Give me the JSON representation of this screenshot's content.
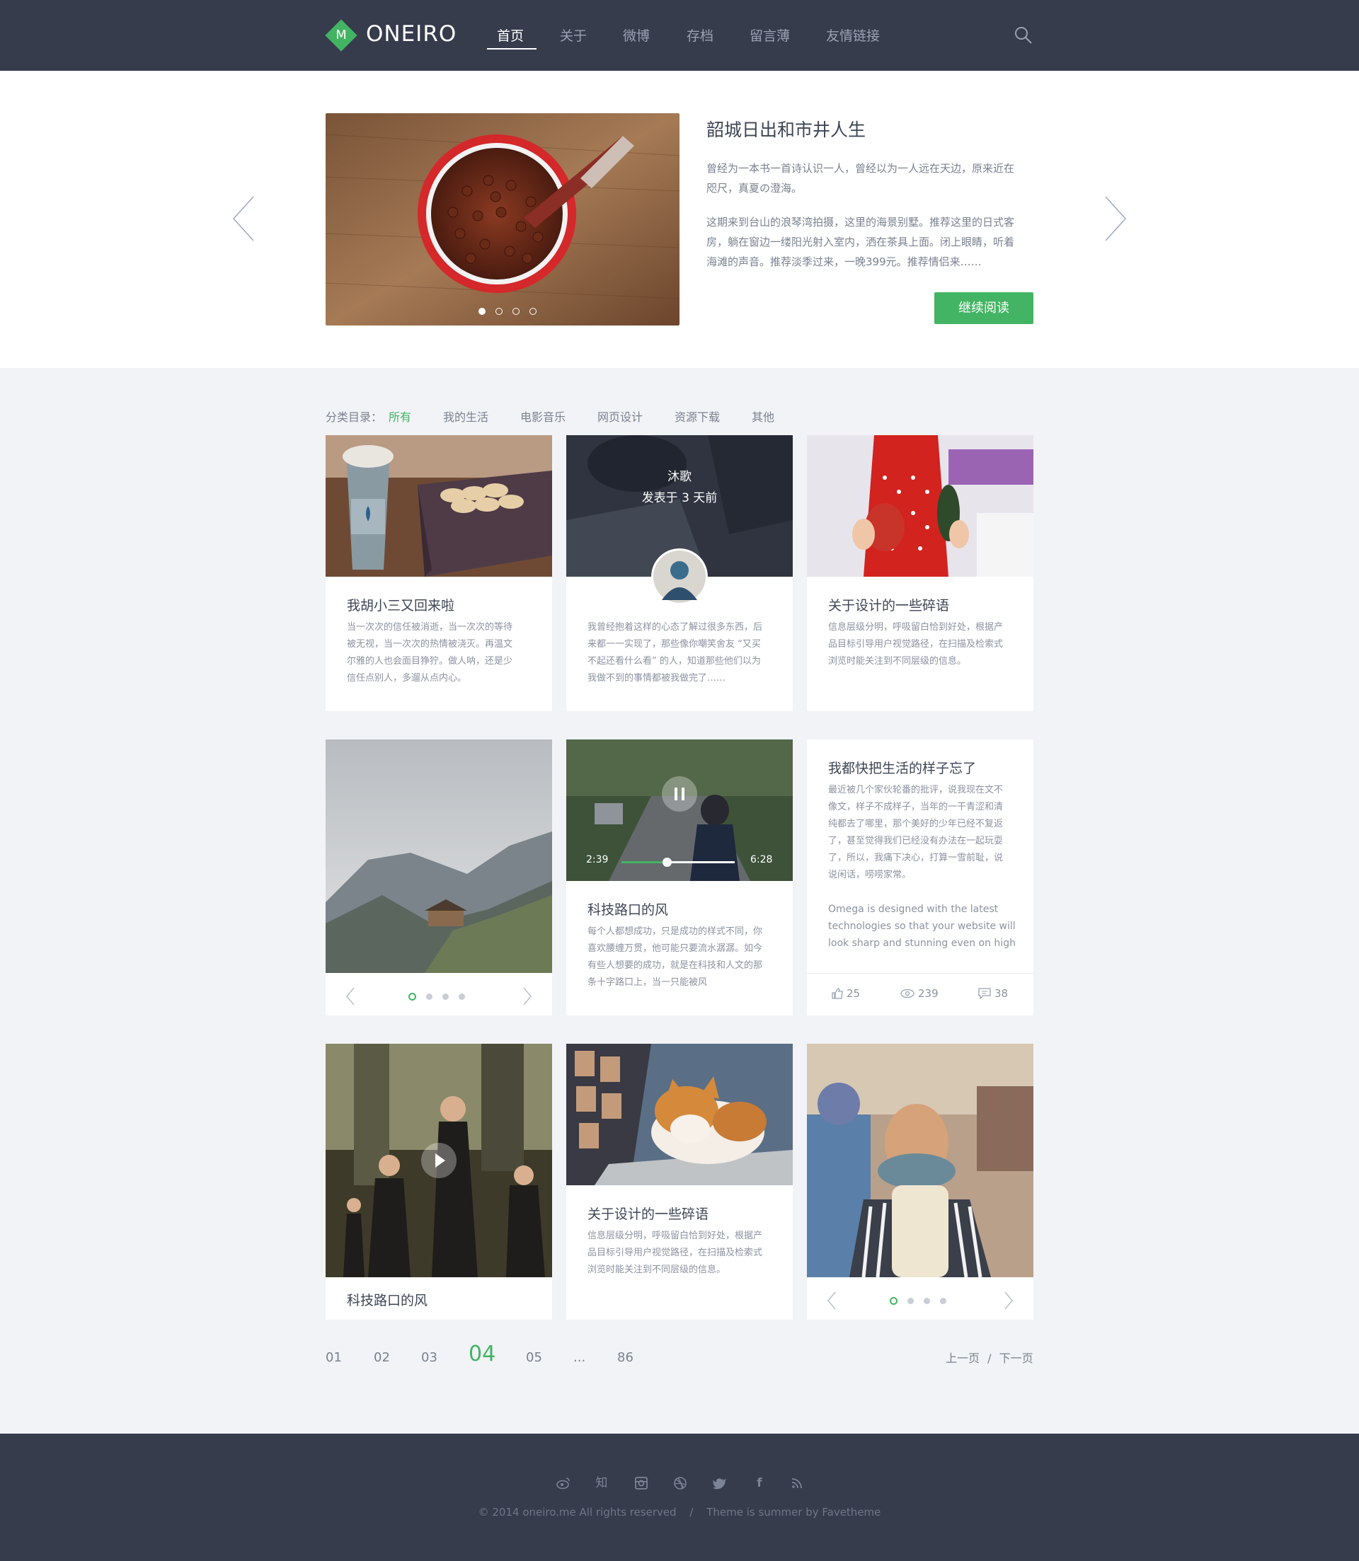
{
  "brand": {
    "logo_letter": "M",
    "name": "ONEIRO"
  },
  "nav": {
    "items": [
      "首页",
      "关于",
      "微博",
      "存档",
      "留言薄",
      "友情链接"
    ],
    "active": "首页"
  },
  "hero": {
    "title": "韶城日出和市井人生",
    "p1_l1": "曾经为一本书一首诗认识一人，曾经以为一人远在天边，原来近在",
    "p1_l2": "咫尺，真夏の澄海。",
    "p2_l1": "这期来到台山的浪琴湾拍摄，这里的海景别墅。推荐这里的日式客",
    "p2_l2": "房，躺在窗边一缕阳光射入室内，洒在茶具上面。闭上眼睛，听着",
    "p2_l3": "海滩的声音。推荐淡季过来，一晚399元。推荐情侣来……",
    "button": "继续阅读",
    "slide_count": 4,
    "slide_active": 1
  },
  "categories": {
    "label": "分类目录：",
    "items": [
      "所有",
      "我的生活",
      "电影音乐",
      "网页设计",
      "资源下载",
      "其他"
    ],
    "active": "所有"
  },
  "cards": {
    "c1": {
      "title": "我胡小三又回来啦",
      "lines": [
        "当一次次的信任被消逝，当一次次的等待",
        "被无视，当一次次的热情被浇灭。再温文",
        "尔雅的人也会面目狰狞。做人呐，还是少",
        "信任点别人，多遛从点内心。"
      ]
    },
    "c2": {
      "author": "沐歌",
      "posted": "发表于 3 天前",
      "lines": [
        "我曾经抱着这样的心态了解过很多东西，后",
        "来都一一实现了，那些像你嘲笑舍友 “又买",
        "不起还看什么看” 的人，知道那些他们以为",
        "我做不到的事情都被我做完了……"
      ]
    },
    "c3": {
      "title": "关于设计的一些碎语",
      "lines": [
        "信息层级分明，呼吸留白恰到好处，根据产",
        "品目标引导用户视觉路径，在扫描及检索式",
        "浏览时能关注到不同层级的信息。"
      ]
    },
    "c4": {
      "slide_count": 4,
      "slide_active": 1
    },
    "c5": {
      "title": "科技路口的风",
      "time_current": "2:39",
      "time_total": "6:28",
      "progress": 0.4,
      "lines": [
        "每个人都想成功，只是成功的样式不同，你",
        "喜欢腰缠万贯，他可能只要流水潺潺。如今",
        "有些人想要的成功，就是在科技和人文的那",
        "条十字路口上，当一只能被风"
      ]
    },
    "c6": {
      "title": "我都快把生活的样子忘了",
      "lines": [
        "最近被几个家伙轮番的批评，说我现在文不",
        "像文，样子不成样子，当年的一干青涩和清",
        "纯都去了哪里，那个美好的少年已经不复返",
        "了，甚至觉得我们已经没有办法在一起玩耍",
        "了，所以，我痛下决心，打算一雪前耻，说",
        "说闲话，唠唠家常。"
      ],
      "en_lines": [
        "Omega is designed with the latest",
        "technologies so that your website will",
        "look sharp and stunning even on high"
      ],
      "likes": "25",
      "views": "239",
      "comments": "38"
    },
    "c7": {
      "title": "科技路口的风"
    },
    "c8": {
      "title": "关于设计的一些碎语",
      "lines": [
        "信息层级分明，呼吸留白恰到好处，根据产",
        "品目标引导用户视觉路径，在扫描及检索式",
        "浏览时能关注到不同层级的信息。"
      ]
    },
    "c9": {
      "slide_count": 4,
      "slide_active": 1
    }
  },
  "pagination": {
    "pages": [
      "01",
      "02",
      "03",
      "04",
      "05",
      "...",
      "86"
    ],
    "current": "04",
    "prev": "上一页",
    "sep": "/",
    "next": "下一页"
  },
  "footer": {
    "icons": [
      "weibo-icon",
      "zhihu-icon",
      "instagram-icon",
      "dribbble-icon",
      "twitter-icon",
      "facebook-icon",
      "rss-icon"
    ],
    "zhihu_label": "知",
    "facebook_label": "f",
    "copyright": "© 2014 oneiro.me All rights reserved",
    "sep": "/",
    "credit": "Theme is summer by Favetheme"
  },
  "colors": {
    "accent": "#43b463",
    "header_bg": "#363c4c",
    "page_bg": "#f1f3f6"
  }
}
